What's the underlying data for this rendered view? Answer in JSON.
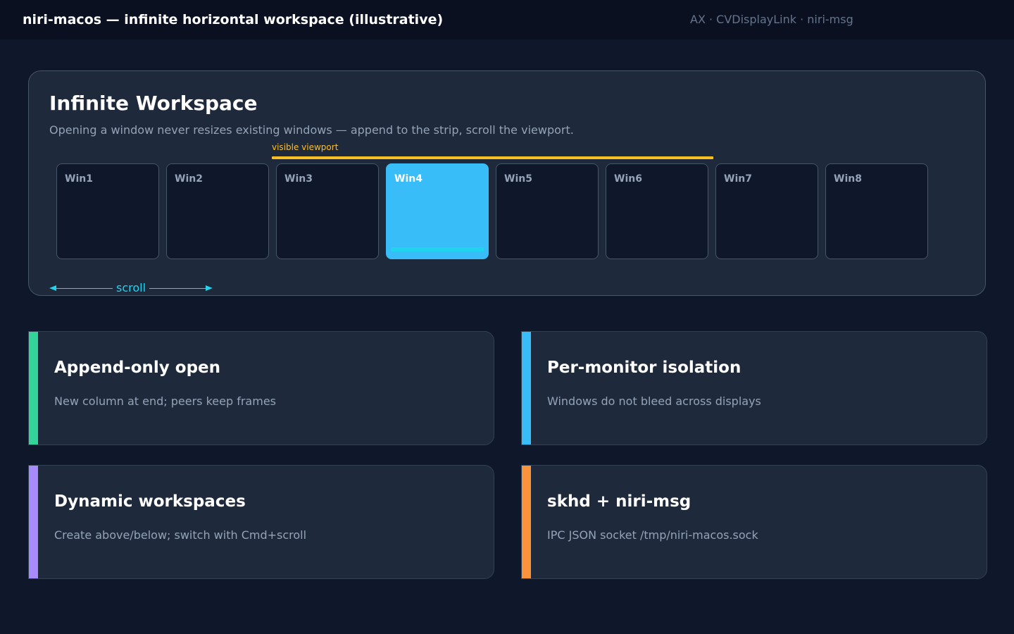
{
  "header": {
    "title": "niri-macos — infinite horizontal workspace (illustrative)",
    "meta": "AX · CVDisplayLink · niri-msg"
  },
  "workspace": {
    "title": "Infinite Workspace",
    "subtitle": "Opening a window never resizes existing windows — append to the strip, scroll the viewport.",
    "viewport_label": "visible viewport",
    "scroll_label": "scroll",
    "focused_index": 3,
    "windows": [
      "Win1",
      "Win2",
      "Win3",
      "Win4",
      "Win5",
      "Win6",
      "Win7",
      "Win8"
    ]
  },
  "cards": [
    {
      "title": "Append-only open",
      "description": "New column at end; peers keep frames",
      "accent": "#34d399"
    },
    {
      "title": "Per-monitor isolation",
      "description": "Windows do not bleed across displays",
      "accent": "#38bdf8"
    },
    {
      "title": "Dynamic workspaces",
      "description": "Create above/below; switch with Cmd+scroll",
      "accent": "#a78bfa"
    },
    {
      "title": "skhd + niri-msg",
      "description": "IPC JSON socket /tmp/niri-macos.sock",
      "accent": "#fb923c"
    }
  ],
  "colors": {
    "background": "#0f172a",
    "panel": "#1e293b",
    "viewport": "#fbbf24",
    "focused": "#38bdf8",
    "scroll": "#22d3ee"
  }
}
